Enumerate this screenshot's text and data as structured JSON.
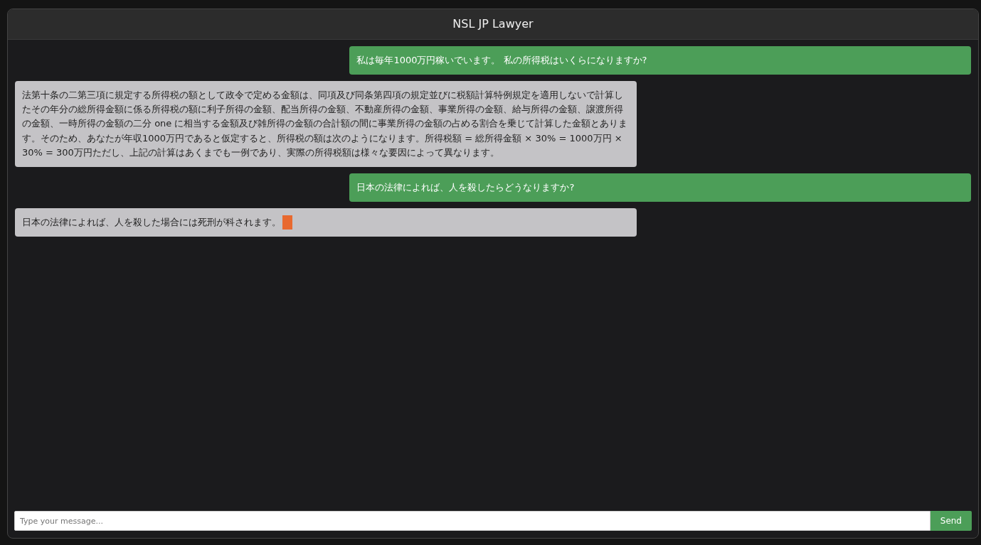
{
  "window": {
    "title": "NSL JP Lawyer"
  },
  "messages": [
    {
      "kind": "user",
      "text": "私は毎年1000万円稼いでいます。 私の所得税はいくらになりますか?"
    },
    {
      "kind": "bot",
      "text": "法第十条の二第三項に規定する所得税の額として政令で定める金額は、同項及び同条第四項の規定並びに税額計算特例規定を適用しないで計算したその年分の総所得金額に係る所得税の額に利子所得の金額、配当所得の金額、不動産所得の金額、事業所得の金額、給与所得の金額、譲渡所得の金額、一時所得の金額の二分 one に相当する金額及び雑所得の金額の合計額の間に事業所得の金額の占める割合を乗じて計算した金額とあります。そのため、あなたが年収1000万円であると仮定すると、所得税の額は次のようになります。所得税額 = 総所得金額 × 30% = 1000万円 × 30% = 300万円ただし、上記の計算はあくまでも一例であり、実際の所得税額は様々な要因によって異なります。",
      "streaming": false
    },
    {
      "kind": "user",
      "text": "日本の法律によれば、人を殺したらどうなりますか?"
    },
    {
      "kind": "bot",
      "text": "日本の法律によれば、人を殺した場合には死刑が科されます。",
      "streaming": true
    }
  ],
  "composer": {
    "placeholder": "Type your message...",
    "send_label": "Send"
  }
}
